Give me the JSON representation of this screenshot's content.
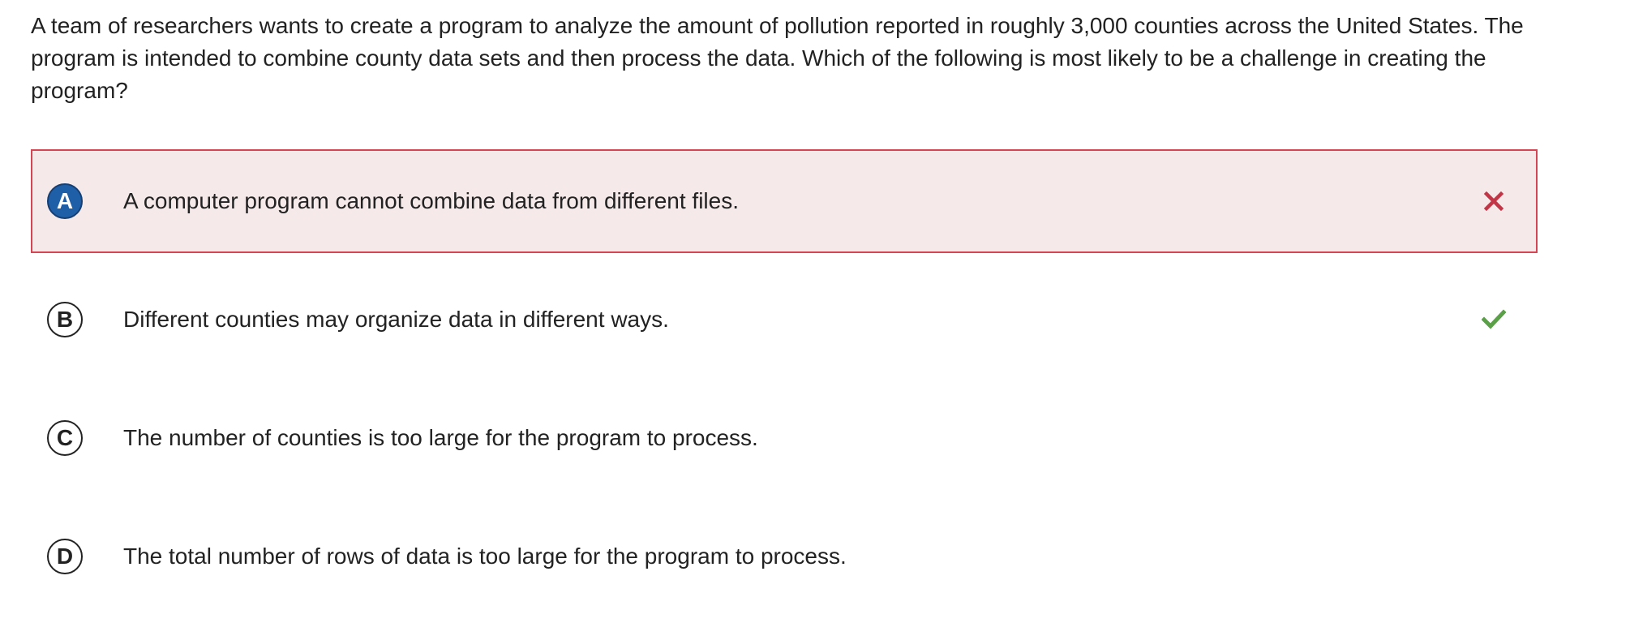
{
  "question": {
    "text": "A team of researchers wants to create a program to analyze the amount of pollution reported in roughly 3,000 counties across the United States. The program is intended to combine county data sets and then process the data. Which of the following is most likely to be a challenge in creating the program?"
  },
  "choices": [
    {
      "letter": "A",
      "text": "A computer program cannot combine data from different files.",
      "state": "selected-incorrect",
      "mark_icon": "x-icon",
      "mark_color": "#c23546"
    },
    {
      "letter": "B",
      "text": "Different counties may organize data in different ways.",
      "state": "correct-answer",
      "mark_icon": "check-icon",
      "mark_color": "#5aa046"
    },
    {
      "letter": "C",
      "text": "The number of counties is too large for the program to process.",
      "state": "unselected"
    },
    {
      "letter": "D",
      "text": "The total number of rows of data is too large for the program to process.",
      "state": "unselected"
    }
  ],
  "colors": {
    "selected_background": "#f5e9e9",
    "selected_border": "#d64553",
    "selected_letter_fill": "#1f5fa8",
    "text": "#222222"
  }
}
